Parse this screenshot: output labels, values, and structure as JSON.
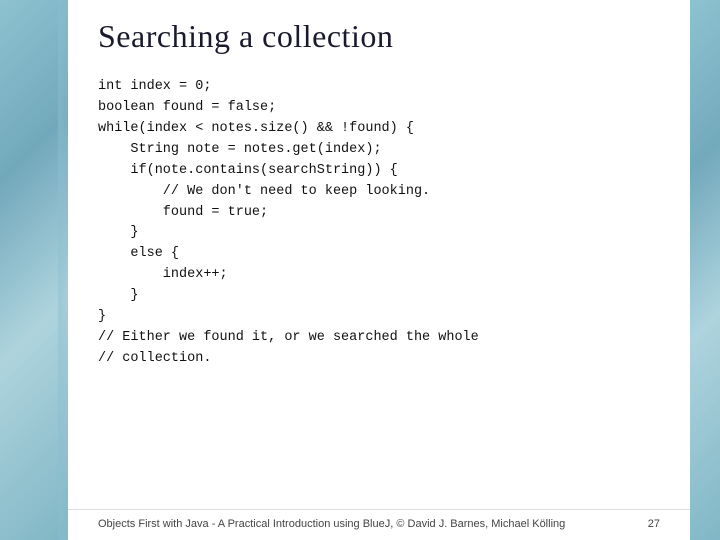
{
  "slide": {
    "title": "Searching a collection",
    "code_lines": [
      "int index = 0;",
      "boolean found = false;",
      "while(index < notes.size() && !found) {",
      "    String note = notes.get(index);",
      "    if(note.contains(searchString)) {",
      "        // We don't need to keep looking.",
      "        found = true;",
      "    }",
      "    else {",
      "        index++;",
      "    }",
      "}",
      "// Either we found it, or we searched the whole",
      "// collection."
    ],
    "footer": {
      "text": "Objects First with Java - A Practical Introduction using BlueJ, © David J. Barnes, Michael Kölling",
      "page": "27"
    }
  }
}
